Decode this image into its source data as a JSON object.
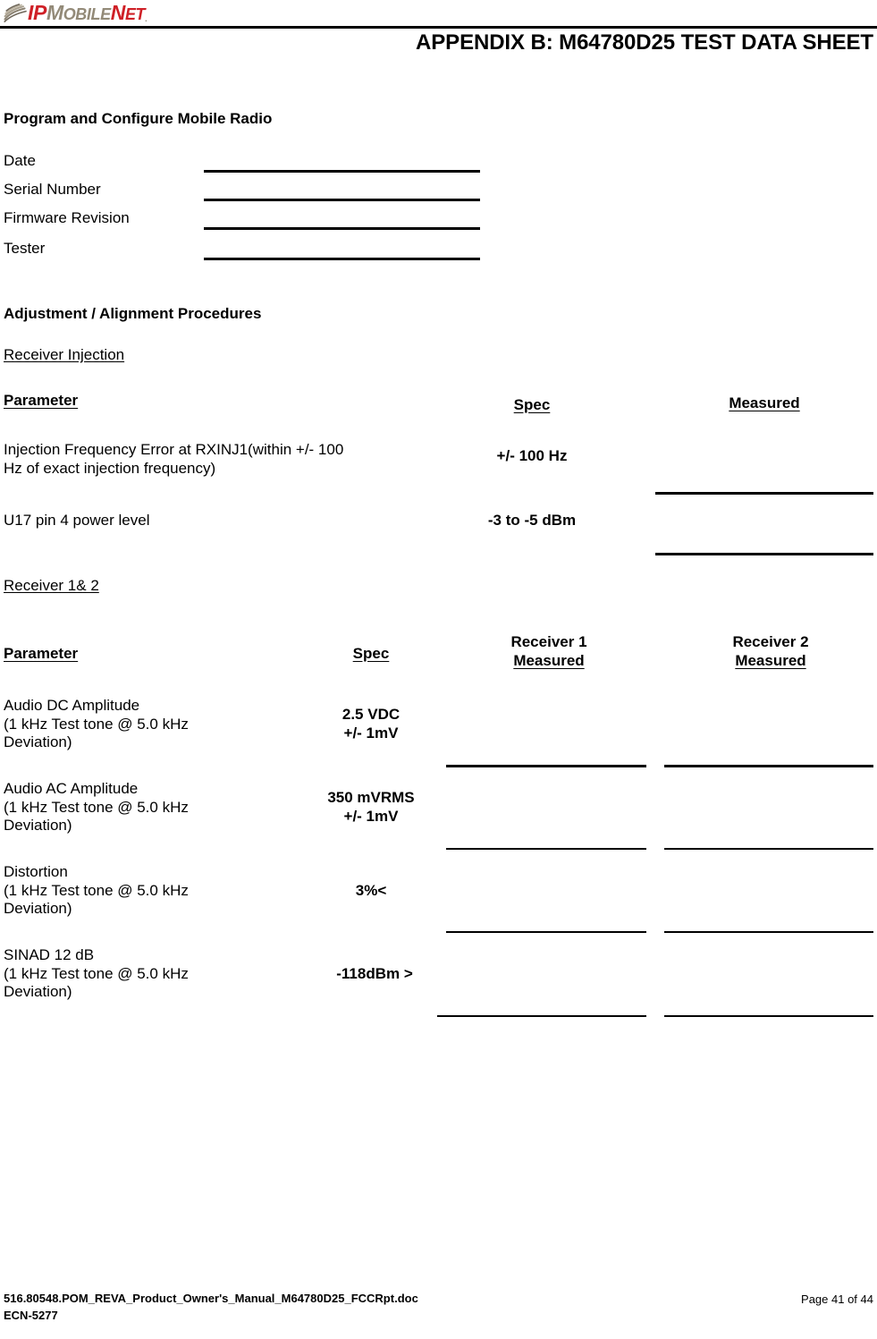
{
  "header": {
    "logo": {
      "part1": "IP",
      "part2_big": "M",
      "part2_rest": "OBILE",
      "part3_big": "N",
      "part3_rest": "ET",
      "trademark": ".",
      "colors": {
        "red": "#cf2027",
        "tan": "#938a78"
      }
    },
    "title": "APPENDIX B:  M64780D25 TEST DATA SHEET"
  },
  "program_section": {
    "heading": "Program and Configure Mobile Radio",
    "fields": [
      {
        "label": "Date",
        "value": ""
      },
      {
        "label": "Serial Number",
        "value": ""
      },
      {
        "label": "Firmware Revision",
        "value": ""
      },
      {
        "label": "Tester",
        "value": ""
      }
    ]
  },
  "adjustment_section": {
    "heading": "Adjustment / Alignment Procedures"
  },
  "receiver_injection": {
    "heading": "Receiver Injection",
    "columns": {
      "parameter": "Parameter",
      "spec": "Spec",
      "measured": "Measured"
    },
    "rows": [
      {
        "parameter_line1": "Injection Frequency Error at RXINJ1(within +/- 100",
        "parameter_line2": "Hz of exact injection frequency)",
        "spec": "+/- 100 Hz",
        "measured": ""
      },
      {
        "parameter_line1": "U17 pin 4 power level",
        "parameter_line2": "",
        "spec": "-3 to -5 dBm",
        "measured": ""
      }
    ]
  },
  "receiver_1_2": {
    "heading": "Receiver 1& 2",
    "columns": {
      "parameter": "Parameter",
      "spec": "Spec",
      "rx1_top": "Receiver 1",
      "rx1_bottom": "Measured",
      "rx2_top": "Receiver 2",
      "rx2_bottom": "Measured"
    },
    "rows": [
      {
        "parameter_line1": "Audio DC Amplitude",
        "parameter_line2": "(1 kHz Test tone @ 5.0 kHz",
        "parameter_line3": "Deviation)",
        "spec_line1": "2.5 VDC",
        "spec_line2": "+/- 1mV",
        "rx1_measured": "",
        "rx2_measured": ""
      },
      {
        "parameter_line1": "Audio AC Amplitude",
        "parameter_line2": "(1 kHz Test tone @ 5.0 kHz",
        "parameter_line3": "Deviation)",
        "spec_line1": "350 mVRMS",
        "spec_line2": "+/- 1mV",
        "rx1_measured": "",
        "rx2_measured": ""
      },
      {
        "parameter_line1": "Distortion",
        "parameter_line2": "(1 kHz Test tone @ 5.0 kHz",
        "parameter_line3": "Deviation)",
        "spec_line1": "3%<",
        "spec_line2": "",
        "rx1_measured": "",
        "rx2_measured": ""
      },
      {
        "parameter_line1": "SINAD 12 dB",
        "parameter_line2": "(1 kHz Test tone @ 5.0 kHz",
        "parameter_line3": "Deviation)",
        "spec_line1": "-118dBm >",
        "spec_line2": "",
        "rx1_measured": "",
        "rx2_measured": ""
      }
    ]
  },
  "footer": {
    "doc_name": "516.80548.POM_REVA_Product_Owner's_Manual_M64780D25_FCCRpt.doc",
    "ecn": "ECN-5277",
    "page": "Page 41 of 44"
  }
}
